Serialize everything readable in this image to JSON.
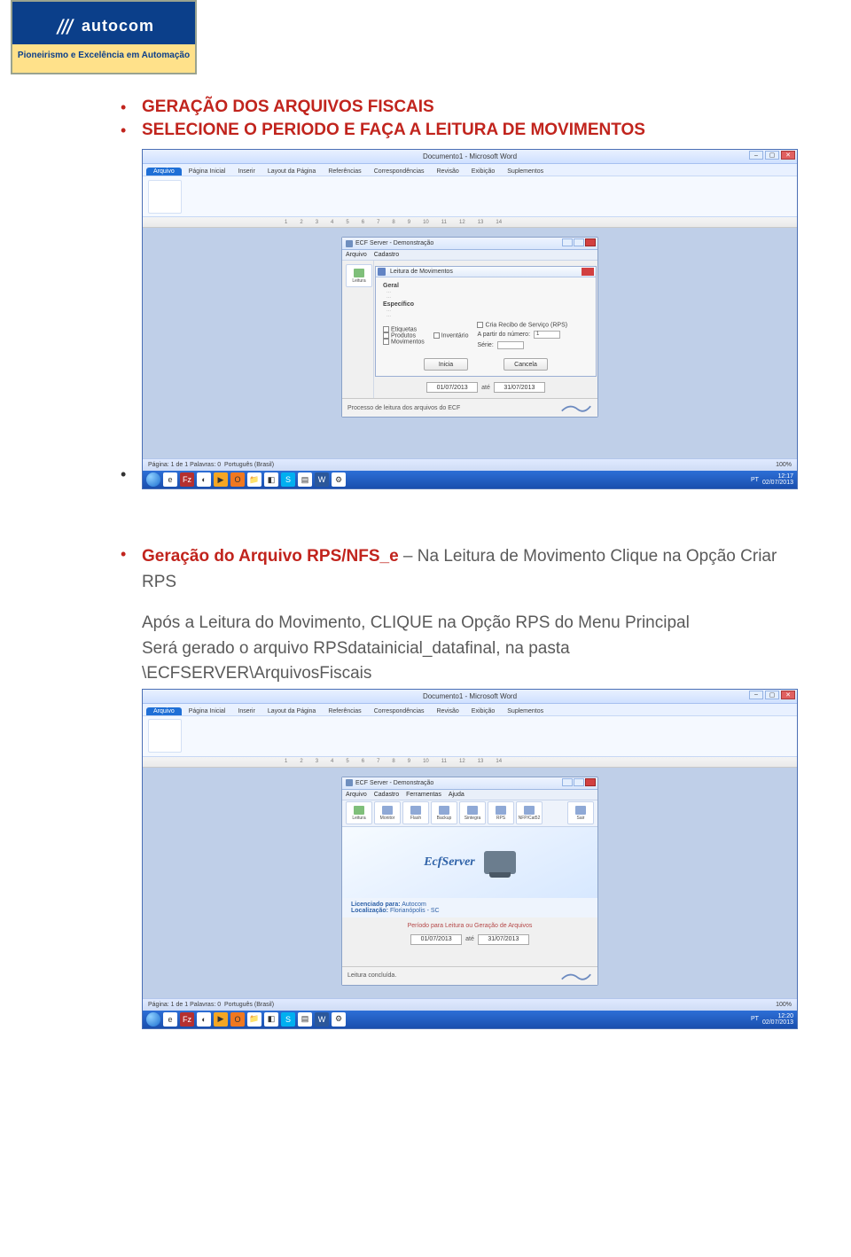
{
  "logo": {
    "brand": "autocom",
    "tagline": "Pioneirismo e Excelência em Automação"
  },
  "section1": {
    "line1": "GERAÇÃO DOS ARQUIVOS FISCAIS",
    "line2": "SELECIONE O PERIODO E FAÇA A LEITURA DE MOVIMENTOS"
  },
  "section2": {
    "lead": "Geração do Arquivo RPS/NFS_e",
    "rest1": " – Na Leitura de Movimento Clique na Opção Criar RPS",
    "para2": "Após a Leitura do Movimento, CLIQUE na Opção RPS do Menu Principal",
    "para3a": "Será gerado o arquivo RPSdatainicial_datafinal,  na pasta",
    "para3b": "\\ECFSERVER\\ArquivosFiscais"
  },
  "word": {
    "title": "Documento1 - Microsoft Word",
    "file": "Arquivo",
    "tabs": [
      "Página Inicial",
      "Inserir",
      "Layout da Página",
      "Referências",
      "Correspondências",
      "Revisão",
      "Exibição",
      "Suplementos"
    ],
    "status_left1": "Página: 1 de 1   Palavras: 0",
    "status_lang": "Português (Brasil)",
    "zoom": "100%"
  },
  "ecf": {
    "title": "ECF Server - Demonstração",
    "menu": [
      "Arquivo",
      "Cadastro",
      "Ferramentas",
      "Ajuda"
    ],
    "side_leitura": "Leitura",
    "splash_name": "EcfServer",
    "license_label": "Licenciado para:",
    "license_name": "Autocom",
    "license_loc_label": "Localização:",
    "license_loc": "Florianópolis - SC",
    "period_hint": "Período para Leitura ou Geração de Arquivos",
    "status_done": "Leitura concluída.",
    "status_proc": "Processo de leitura dos arquivos do ECF"
  },
  "dialog": {
    "title": "Leitura de Movimentos",
    "geral": "Geral",
    "especifico": "Específico",
    "chk_etiq": "Etiquetas",
    "chk_inv": "Inventário",
    "chk_prod": "Produtos",
    "chk_mov": "Movimentos",
    "chk_rps": "Cria Recibo de Serviço (RPS)",
    "num_label": "A partir do número:",
    "num_val": "1",
    "serie_label": "Série:",
    "btn_inicia": "Inicia",
    "btn_cancela": "Cancela"
  },
  "dates": {
    "from": "01/07/2013",
    "to": "31/07/2013",
    "sep": "até"
  },
  "toolbar": {
    "btns": [
      "Leitura",
      "Monitor",
      "Flash",
      "Backup",
      "Sintegra",
      "RPS",
      "NFP/Cat52",
      "Sair"
    ]
  },
  "tray": {
    "lang": "PT",
    "time1": "12:17",
    "date1": "02/07/2013",
    "time2": "12:20",
    "date2": "02/07/2013"
  }
}
